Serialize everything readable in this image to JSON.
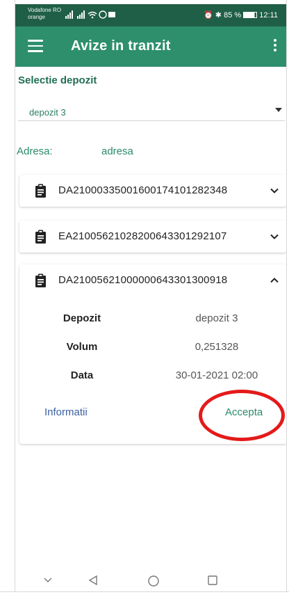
{
  "status_bar": {
    "carrier_line1": "Vodafone RO",
    "carrier_line2": "orange",
    "battery": "85 %",
    "time": "12:11"
  },
  "app_bar": {
    "title": "Avize in tranzit"
  },
  "selection": {
    "label": "Selectie depozit",
    "selected": "depozit 3"
  },
  "address": {
    "label": "Adresa:",
    "value": "adresa"
  },
  "cards": [
    {
      "id": "DA21000335001600174101282348",
      "expanded": false
    },
    {
      "id": "EA21005621028200643301292107",
      "expanded": false
    },
    {
      "id": "DA21005621000000643301300918",
      "expanded": true,
      "details": [
        {
          "key": "Depozit",
          "value": "depozit 3"
        },
        {
          "key": "Volum",
          "value": "0,251328"
        },
        {
          "key": "Data",
          "value": "30-01-2021 02:00"
        }
      ],
      "actions": {
        "info": "Informatii",
        "accept": "Accepta"
      }
    }
  ],
  "colors": {
    "app_bar": "#2e8f6d",
    "status_bar": "#1f5e47",
    "accent_text": "#2a8a6a",
    "highlight": "#e41a1a"
  },
  "icons": [
    "menu-icon",
    "more-vert-icon",
    "clipboard-icon",
    "chevron-down-icon",
    "chevron-up-icon",
    "nav-back-icon",
    "nav-home-icon",
    "nav-recents-icon",
    "nav-collapse-icon"
  ]
}
